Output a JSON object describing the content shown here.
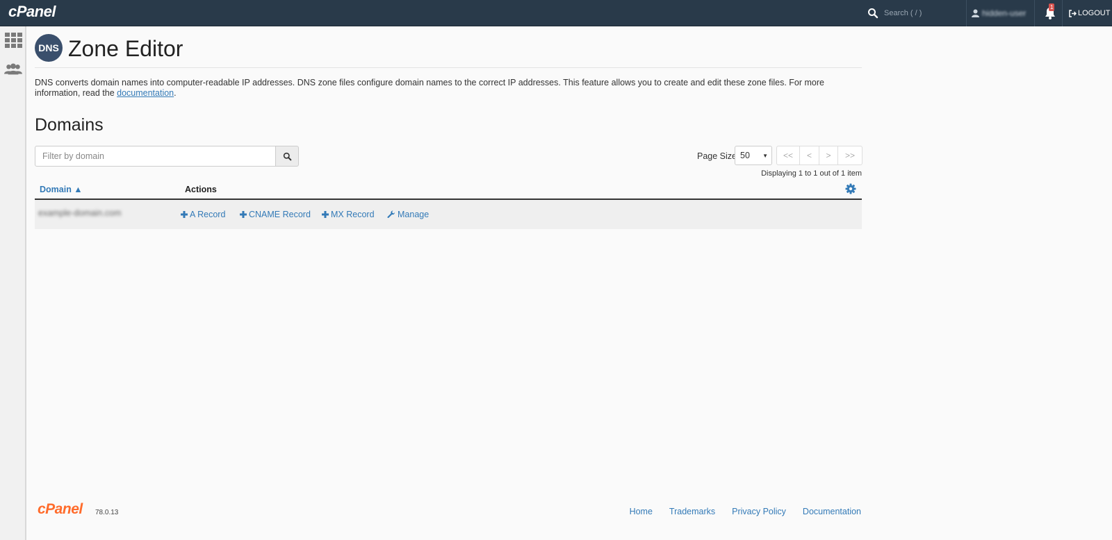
{
  "topbar": {
    "logo": "cPanel",
    "search_placeholder": "Search ( / )",
    "username": "hidden-user",
    "notification_count": "1",
    "logout_label": "LOGOUT"
  },
  "page": {
    "title": "Zone Editor",
    "badge_text": "DNS",
    "description_before": "DNS converts domain names into computer-readable IP addresses. DNS zone files configure domain names to the correct IP addresses. This feature allows you to create and edit these zone files. For more information, read the ",
    "description_link": "documentation",
    "description_after": "."
  },
  "domains": {
    "title": "Domains",
    "filter_placeholder": "Filter by domain",
    "page_size_label": "Page Size",
    "page_size_value": "50",
    "pager": {
      "first": "<<",
      "prev": "<",
      "next": ">",
      "last": ">>"
    },
    "displaying": "Displaying 1 to 1 out of 1 item",
    "columns": {
      "domain": "Domain ▲",
      "actions": "Actions"
    },
    "rows": [
      {
        "domain": "example-domain.com",
        "actions": [
          "A Record",
          "CNAME Record",
          "MX Record",
          "Manage"
        ]
      }
    ]
  },
  "footer": {
    "logo": "cPanel",
    "version": "78.0.13",
    "links": [
      "Home",
      "Trademarks",
      "Privacy Policy",
      "Documentation"
    ]
  },
  "colors": {
    "topbar": "#293a4a",
    "link": "#337ab7",
    "brand_orange": "#ff6c2c",
    "badge_red": "#d9534f"
  },
  "icons": {
    "search": "search-icon",
    "user": "user-icon",
    "bell": "bell-icon",
    "logout": "logout-icon",
    "grid": "grid-icon",
    "users": "users-icon",
    "gear": "gear-icon",
    "plus": "plus-icon",
    "wrench": "wrench-icon"
  }
}
